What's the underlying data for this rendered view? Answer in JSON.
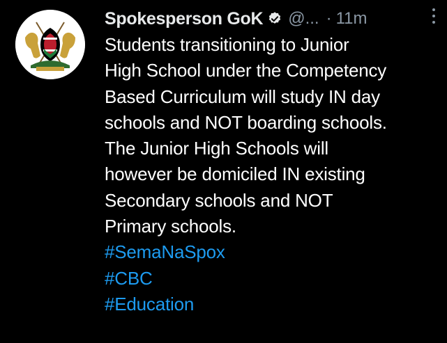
{
  "tweet": {
    "author_name": "Spokesperson GoK",
    "handle": "@...",
    "separator": "·",
    "time": "11m",
    "body_lines": [
      "Students transitioning to Junior",
      "High School under the Competency",
      "Based Curriculum will study IN day",
      "schools and NOT boarding schools.",
      "The Junior High Schools will",
      "however be domiciled IN existing",
      "Secondary schools and NOT",
      "Primary schools."
    ],
    "hashtags": [
      "#SemaNaSpox",
      "#CBC",
      "#Education"
    ]
  },
  "icons": {
    "avatar": "kenya-coat-of-arms-icon",
    "verified": "verified-badge-icon",
    "more": "more-vertical-icon"
  },
  "colors": {
    "background": "#000000",
    "text": "#ffffff",
    "muted": "#8b98a5",
    "link": "#1d9bf0"
  }
}
